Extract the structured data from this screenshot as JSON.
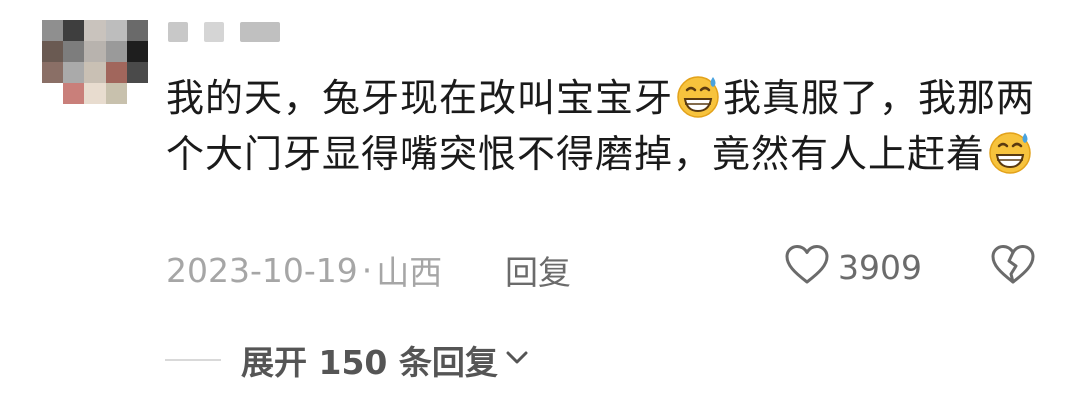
{
  "comment": {
    "text_segments": [
      "我的天，兔牙现在改叫宝宝牙",
      "我真服了，我那两个大门牙显得嘴突恨不得磨掉，竟然有人上赶着"
    ],
    "emoji_name": "grinning-face-with-sweat-icon",
    "date": "2023-10-19",
    "separator": "·",
    "location": "山西",
    "reply_label": "回复",
    "like_count": "3909"
  },
  "expand": {
    "label": "展开 150 条回复"
  },
  "colors": {
    "text": "#1a1a1a",
    "meta": "#a6a6a6",
    "action": "#6b6b6b",
    "emoji_face": "#f7c33d",
    "emoji_sweat": "#4aa3df"
  },
  "avatar_pixels": [
    "#8f8f8f",
    "#3e3e3e",
    "#c9c3bd",
    "#bdbdbd",
    "#6a6a6a",
    "#6a5a52",
    "#7d7d7d",
    "#b8b3ae",
    "#9a9a9a",
    "#1e1e1e",
    "#8a6f66",
    "#aaaaaa",
    "#c9c0b4",
    "#a1665c",
    "#4a4a4a",
    "#ffffff",
    "#c97f7a",
    "#e8dccf",
    "#c8c1ad",
    "#ffffff"
  ],
  "username_blocks": [
    "#c8c8c8",
    "#d5d5d5",
    "#c0c0c0"
  ]
}
